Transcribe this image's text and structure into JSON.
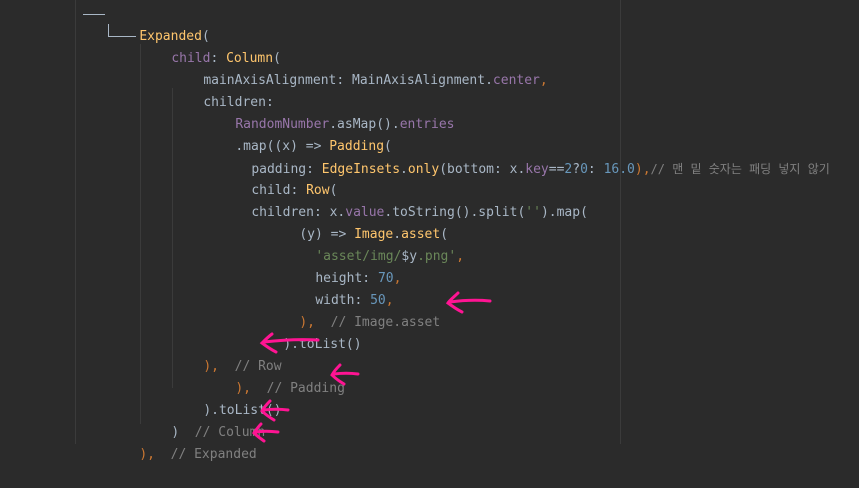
{
  "code": {
    "l1": {
      "name": "Expanded",
      "tail": "("
    },
    "l2": {
      "a": "child",
      "b": ": ",
      "c": "Column",
      "d": "("
    },
    "l3": {
      "a": "mainAxisAlignment",
      "b": ": MainAxisAlignment.",
      "c": "center",
      "d": ","
    },
    "l4": {
      "a": "children",
      "b": ":"
    },
    "l5": {
      "a": "RandomNumber",
      "b": ".asMap().",
      "c": "entries"
    },
    "l6": {
      "a": ".map((x) => ",
      "b": "Padding",
      "c": "("
    },
    "l7": {
      "a": "padding",
      "b": ": ",
      "c": "EdgeInsets",
      "d": ".",
      "e": "only",
      "f": "(bottom: x.",
      "g": "key",
      "h": "==",
      "i": "2",
      "j": "?",
      "k": "0",
      "l": ": ",
      "m": "16.0",
      "n": "),",
      "o": "// 맨 밑 숫자는 패딩 넣지 않기"
    },
    "l8": {
      "a": "child",
      "b": ": ",
      "c": "Row",
      "d": "("
    },
    "l9": {
      "a": "children",
      "b": ": x.",
      "c": "value",
      "d": ".toString().split(",
      "e": "''",
      "f": ").map("
    },
    "l10": {
      "a": "(y) => ",
      "b": "Image",
      "c": ".",
      "d": "asset",
      "e": "("
    },
    "l11": {
      "a": "'asset/img/",
      "b": "$y",
      "c": ".png'",
      "d": ","
    },
    "l12": {
      "a": "height",
      "b": ": ",
      "c": "70",
      "d": ","
    },
    "l13": {
      "a": "width",
      "b": ": ",
      "c": "50",
      "d": ","
    },
    "l14": {
      "a": "),  ",
      "b": "// Image.asset"
    },
    "l15": {
      "a": ").toList()"
    },
    "l16": {
      "a": "),  ",
      "b": "// Row"
    },
    "l17": {
      "a": "),  ",
      "b": "// Padding"
    },
    "l18": {
      "a": ").toList()"
    },
    "l19": {
      "a": ")  ",
      "b": "// Column"
    },
    "l20": {
      "a": "),  ",
      "b": "// Expanded"
    }
  },
  "annotations": {
    "arrow_color": "#ff1493"
  },
  "theme": {
    "background": "#2b2b2b",
    "keyword": "#cc7832",
    "class": "#ffc66d",
    "property": "#9876aa",
    "number": "#6897bb",
    "string": "#6a8759",
    "comment": "#808080"
  }
}
